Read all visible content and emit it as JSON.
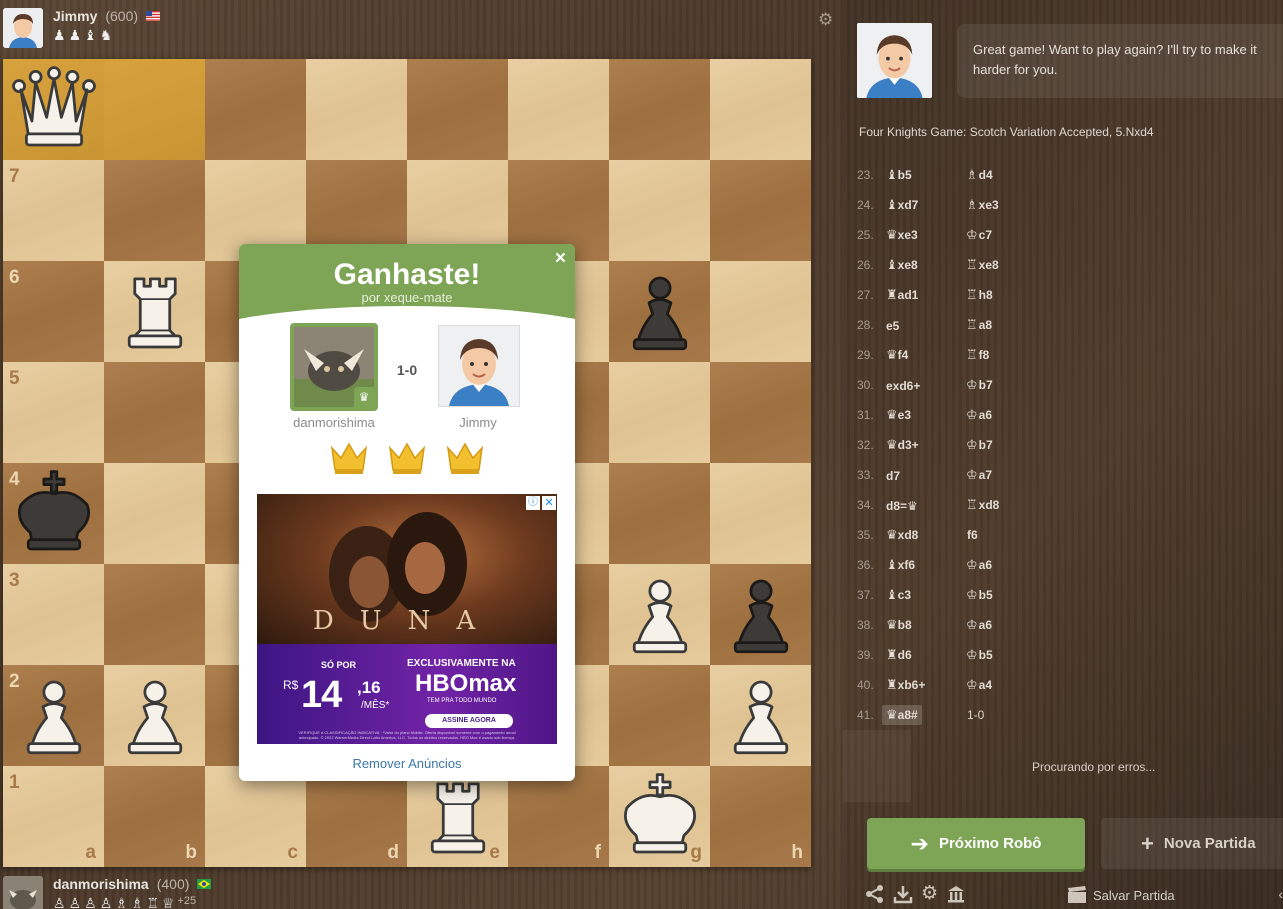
{
  "top_player": {
    "name": "Jimmy",
    "rating": "(600)",
    "flag": "us-flag",
    "captured": [
      "♟",
      "♟",
      "♝",
      "♞"
    ]
  },
  "bottom_player": {
    "name": "danmorishima",
    "rating": "(400)",
    "flag": "br-flag",
    "captured": [
      "♙",
      "♙",
      "♙",
      "♙",
      "♗",
      "♗",
      "♖",
      "♕"
    ],
    "advantage": "+25"
  },
  "board": {
    "ranks": [
      "",
      "7",
      "6",
      "5",
      "4",
      "3",
      "2",
      "1"
    ],
    "files": [
      "a",
      "b",
      "c",
      "d",
      "e",
      "f",
      "g",
      "h"
    ],
    "highlight": [
      "a8",
      "b8"
    ],
    "pieces": [
      {
        "sq": "a8",
        "piece": "wQ"
      },
      {
        "sq": "b6",
        "piece": "wR"
      },
      {
        "sq": "g6",
        "piece": "bP"
      },
      {
        "sq": "a4",
        "piece": "bK"
      },
      {
        "sq": "g3",
        "piece": "wP"
      },
      {
        "sq": "h3",
        "piece": "bP"
      },
      {
        "sq": "a2",
        "piece": "wP"
      },
      {
        "sq": "b2",
        "piece": "wP"
      },
      {
        "sq": "h2",
        "piece": "wP"
      },
      {
        "sq": "e1",
        "piece": "wR"
      },
      {
        "sq": "g1",
        "piece": "wK"
      }
    ]
  },
  "modal": {
    "title": "Ganhaste!",
    "subtitle": "por xeque-mate",
    "close": "×",
    "score": "1-0",
    "winner": "danmorishima",
    "loser": "Jimmy",
    "crowns": 3,
    "ad": {
      "movie": "DUNA",
      "so_por": "SÓ POR",
      "currency": "R$",
      "price": "14",
      "cents": ",16",
      "per": "/MÊS*",
      "exclusive": "EXCLUSIVAMENTE NA",
      "brand": "HBOmax",
      "tagline": "TEM PRA TODO MUNDO",
      "cta": "ASSINE AGORA",
      "fine": "VERIFIQUE A CLASSIFICAÇÃO INDICATIVA · *Valor do plano Mobile. Oferta disponível somente com o pagamento anual antecipado. © 2022 WarnerMedia Direct Latin America, LLC. Todos os direitos reservados. HBO Max é usado sob licença.",
      "info": "ⓘ",
      "x": "✕"
    },
    "remove_ads": "Remover Anúncios"
  },
  "sidebar": {
    "speech": "Great game! Want to play again? I'll try to make it harder for you.",
    "opening": "Four Knights Game: Scotch Variation Accepted, 5.Nxd4",
    "moves": [
      {
        "n": "23.",
        "wp": "♝",
        "w": "b5",
        "bp": "♗",
        "b": "d4"
      },
      {
        "n": "24.",
        "wp": "♝",
        "w": "xd7",
        "bp": "♗",
        "b": "xe3"
      },
      {
        "n": "25.",
        "wp": "♛",
        "w": "xe3",
        "bp": "♔",
        "b": "c7"
      },
      {
        "n": "26.",
        "wp": "♝",
        "w": "xe8",
        "bp": "♖",
        "b": "xe8"
      },
      {
        "n": "27.",
        "wp": "♜",
        "w": "ad1",
        "bp": "♖",
        "b": "h8"
      },
      {
        "n": "28.",
        "wp": "",
        "w": "e5",
        "bp": "♖",
        "b": "a8"
      },
      {
        "n": "29.",
        "wp": "♛",
        "w": "f4",
        "bp": "♖",
        "b": "f8"
      },
      {
        "n": "30.",
        "wp": "",
        "w": "exd6+",
        "bp": "♔",
        "b": "b7"
      },
      {
        "n": "31.",
        "wp": "♛",
        "w": "e3",
        "bp": "♔",
        "b": "a6"
      },
      {
        "n": "32.",
        "wp": "♛",
        "w": "d3+",
        "bp": "♔",
        "b": "b7"
      },
      {
        "n": "33.",
        "wp": "",
        "w": "d7",
        "bp": "♔",
        "b": "a7"
      },
      {
        "n": "34.",
        "wp": "",
        "w": "d8=♛",
        "bp": "♖",
        "b": "xd8"
      },
      {
        "n": "35.",
        "wp": "♛",
        "w": "xd8",
        "bp": "",
        "b": "f6"
      },
      {
        "n": "36.",
        "wp": "♝",
        "w": "xf6",
        "bp": "♔",
        "b": "a6"
      },
      {
        "n": "37.",
        "wp": "♝",
        "w": "c3",
        "bp": "♔",
        "b": "b5"
      },
      {
        "n": "38.",
        "wp": "♛",
        "w": "b8",
        "bp": "♔",
        "b": "a6"
      },
      {
        "n": "39.",
        "wp": "♜",
        "w": "d6",
        "bp": "♔",
        "b": "b5"
      },
      {
        "n": "40.",
        "wp": "♜",
        "w": "xb6+",
        "bp": "♔",
        "b": "a4"
      },
      {
        "n": "41.",
        "wp": "♛",
        "w": "a8#",
        "bp": "",
        "b": "1-0",
        "selected": true
      }
    ],
    "search": "Procurando por erros...",
    "next_bot": "Próximo Robô",
    "next_arrow": "➔",
    "new_game": "Nova Partida",
    "new_plus": "+",
    "tools": [
      "share-icon",
      "download-icon",
      "gear-icon",
      "analysis-icon"
    ],
    "save": "Salvar Partida"
  }
}
